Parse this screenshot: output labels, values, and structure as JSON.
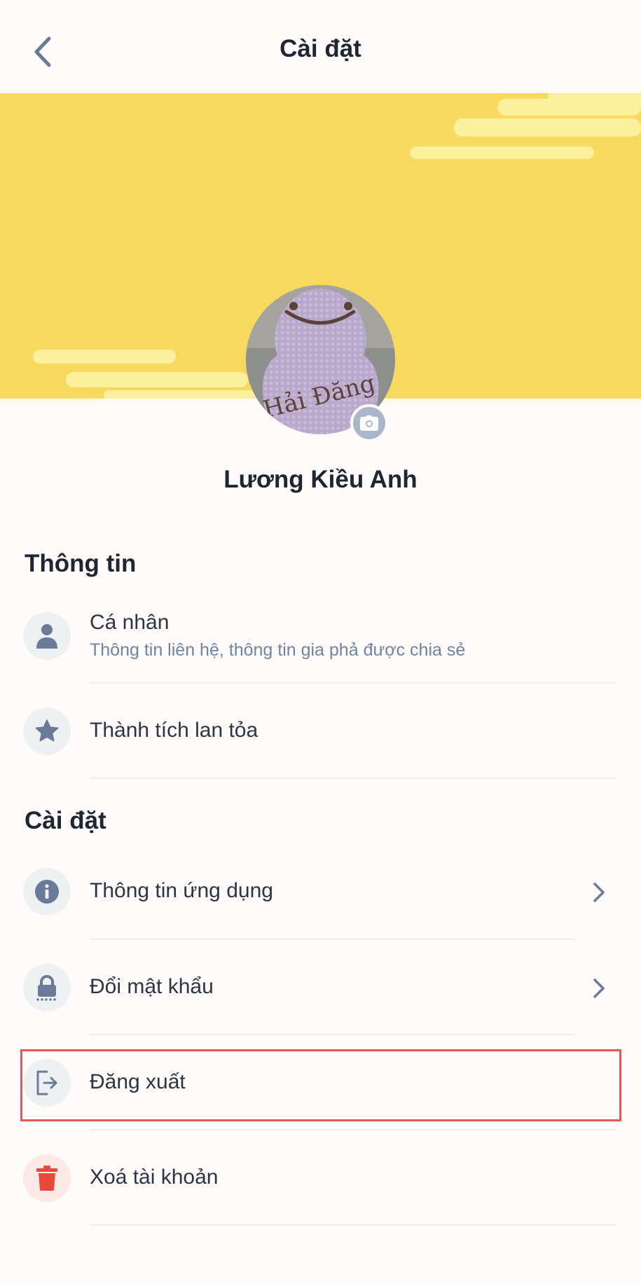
{
  "header": {
    "title": "Cài đặt",
    "back_icon": "chevron-left-icon"
  },
  "profile": {
    "name": "Lương Kiều Anh",
    "avatar_text": "Hải Đăng",
    "camera_icon": "camera-icon"
  },
  "sections": {
    "info": {
      "title": "Thông tin",
      "items": [
        {
          "label": "Cá nhân",
          "sublabel": "Thông tin liên hệ, thông tin gia phả được chia sẻ",
          "icon": "person-icon"
        },
        {
          "label": "Thành tích lan tỏa",
          "icon": "star-icon"
        }
      ]
    },
    "settings": {
      "title": "Cài đặt",
      "items": [
        {
          "label": "Thông tin ứng dụng",
          "icon": "info-icon",
          "has_chevron": true
        },
        {
          "label": "Đổi mật khẩu",
          "icon": "lock-icon",
          "has_chevron": true
        },
        {
          "label": "Đăng xuất",
          "icon": "logout-icon"
        },
        {
          "label": "Xoá tài khoản",
          "icon": "trash-icon"
        }
      ]
    }
  },
  "colors": {
    "banner": "#f8d95f",
    "cloud": "#fcef9d",
    "icon_bg": "#eef1f2",
    "icon": "#6c7a99",
    "danger": "#e8493a",
    "highlight": "#e35b52"
  }
}
